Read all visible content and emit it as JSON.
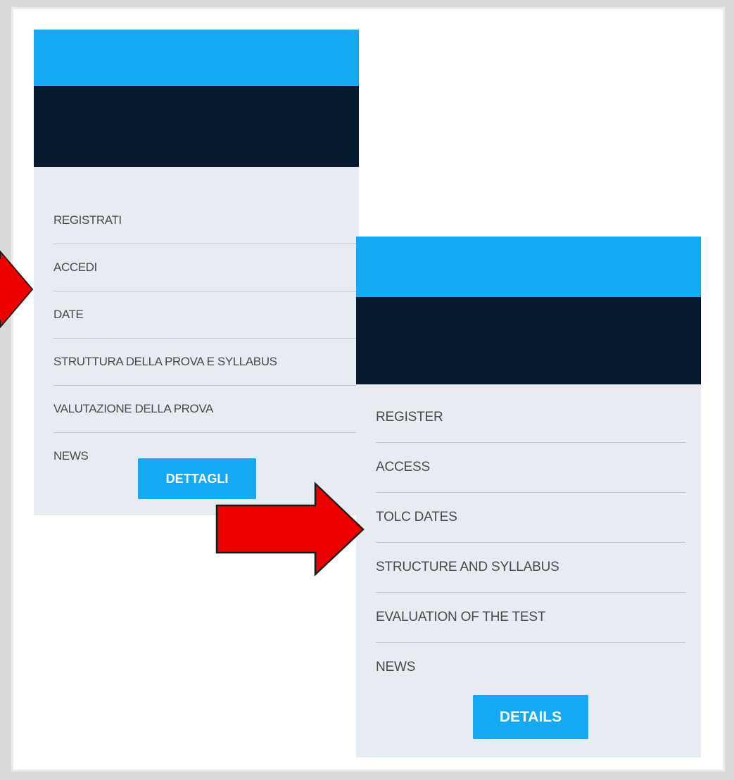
{
  "italian_panel": {
    "menu_items": [
      {
        "label": "REGISTRATI"
      },
      {
        "label": "ACCEDI"
      },
      {
        "label": "DATE"
      },
      {
        "label": "STRUTTURA DELLA PROVA E SYLLABUS"
      },
      {
        "label": "VALUTAZIONE DELLA PROVA"
      },
      {
        "label": "NEWS"
      }
    ],
    "button_label": "DETTAGLI",
    "highlighted_item": "DATE"
  },
  "english_panel": {
    "menu_items": [
      {
        "label": "REGISTER"
      },
      {
        "label": "ACCESS"
      },
      {
        "label": "TOLC DATES"
      },
      {
        "label": "STRUCTURE AND SYLLABUS"
      },
      {
        "label": "EVALUATION OF THE TEST"
      },
      {
        "label": "NEWS"
      }
    ],
    "button_label": "DETAILS",
    "highlighted_item": "TOLC DATES"
  },
  "colors": {
    "header_blue": "#14a9f3",
    "header_dark": "#071a2d",
    "panel_background": "#e7ecf3",
    "arrow_fill": "#ee0000",
    "arrow_stroke": "#1a1a1a"
  },
  "icons": [
    "right-arrow-icon"
  ]
}
